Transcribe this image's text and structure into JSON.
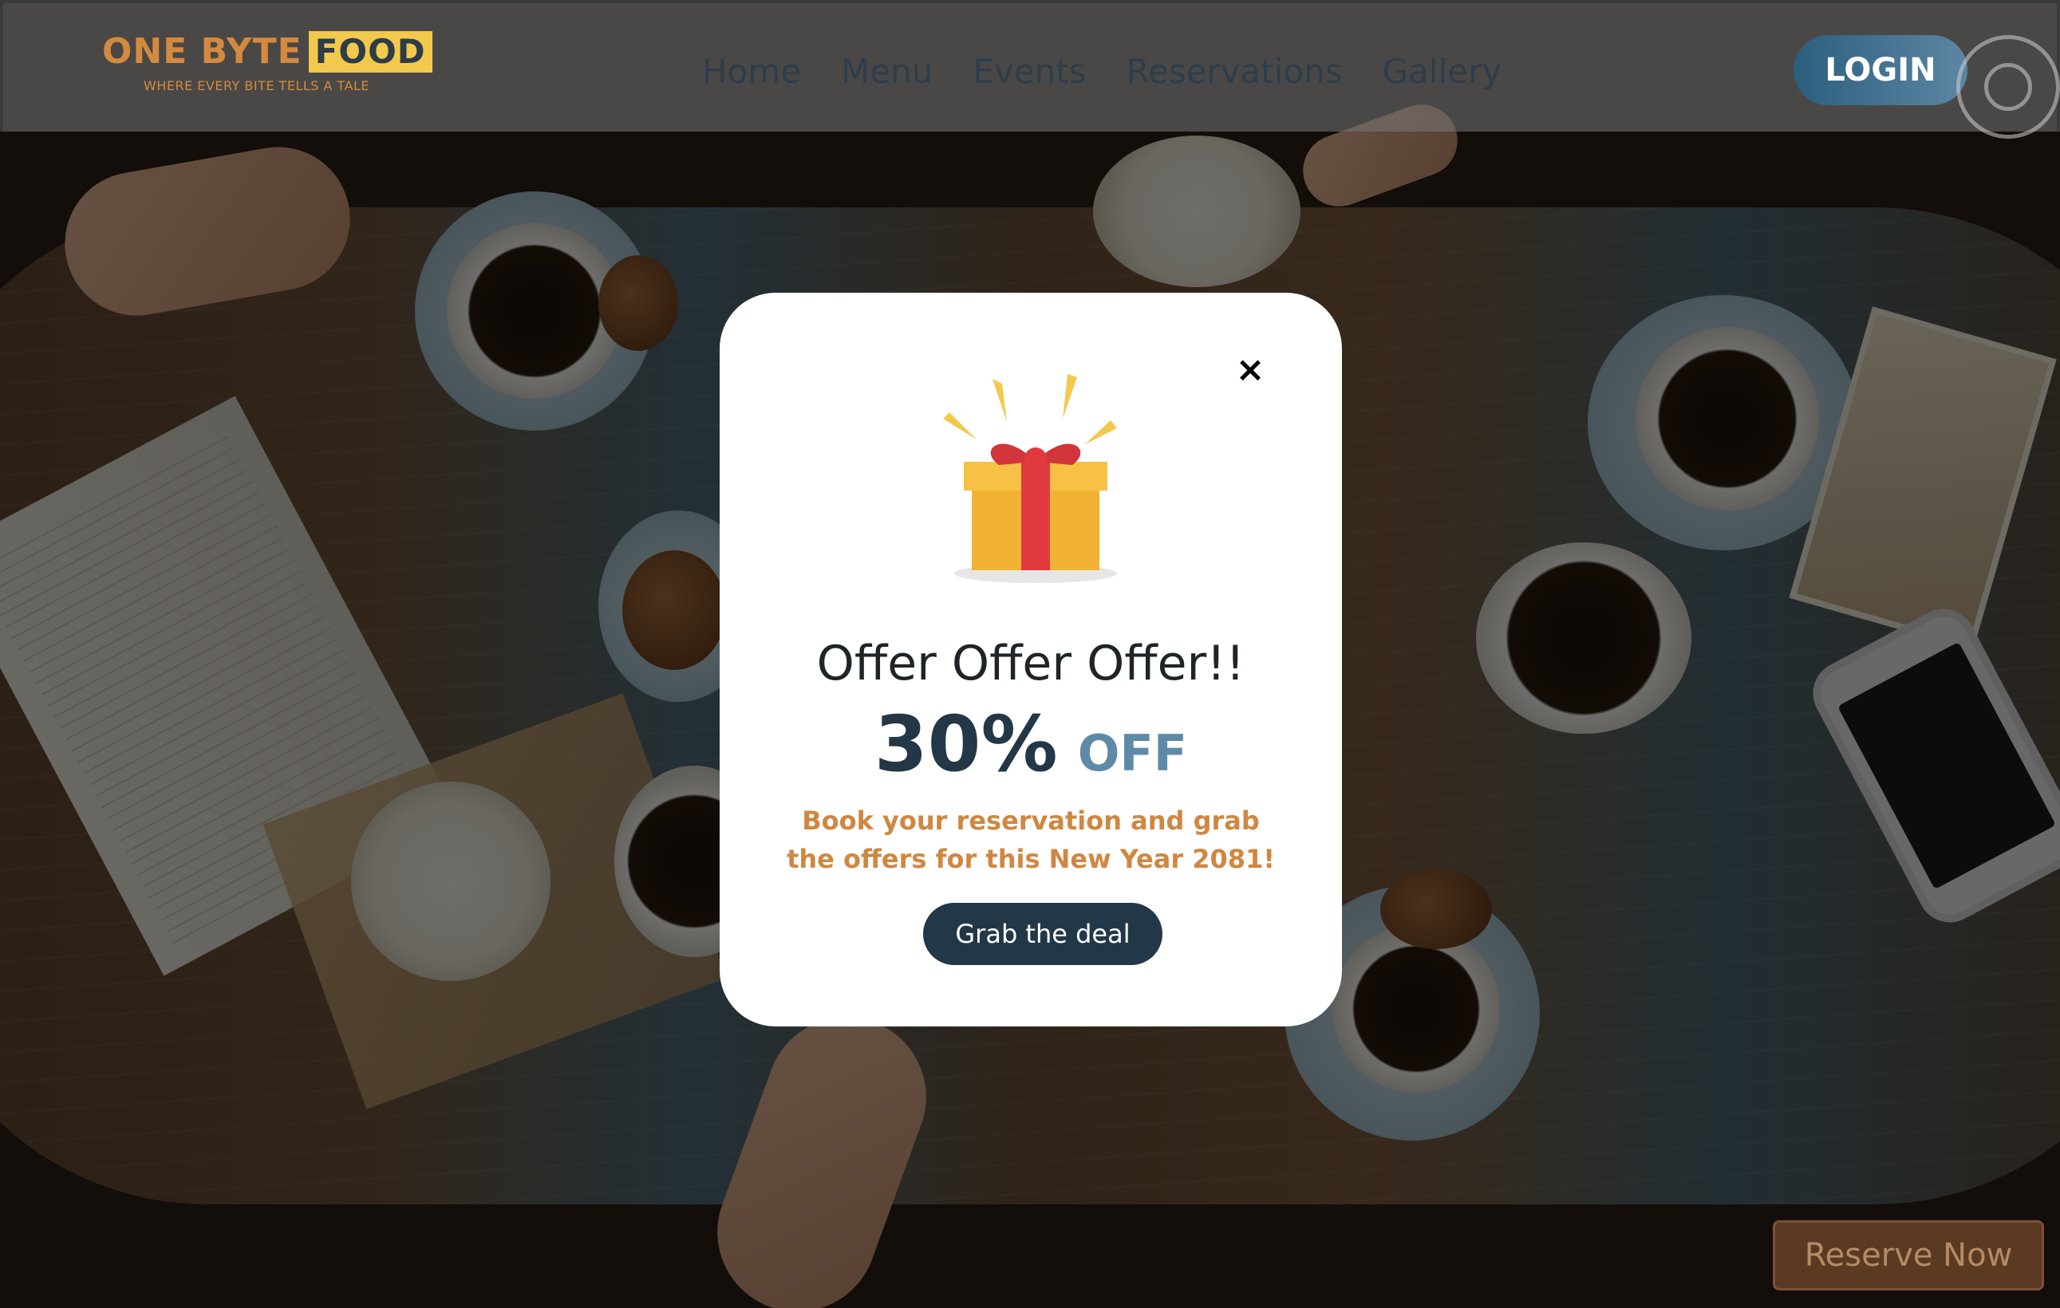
{
  "brand": {
    "name_first": "ONE BYTE",
    "name_second": "FOOD",
    "tagline": "WHERE EVERY BITE TELLS A TALE"
  },
  "nav": {
    "links": [
      "Home",
      "Menu",
      "Events",
      "Reservations",
      "Gallery"
    ],
    "login_label": "LOGIN"
  },
  "modal": {
    "close_symbol": "×",
    "title": "Offer Offer Offer!!",
    "discount_value": "30%",
    "discount_suffix": "OFF",
    "description": "Book your reservation and grab the offers for this New Year 2081!",
    "cta_label": "Grab the deal",
    "icon": "gift-icon"
  },
  "reserve": {
    "label": "Reserve Now"
  },
  "colors": {
    "brand_orange": "#d38a3f",
    "brand_yellow": "#f2c94c",
    "navy": "#223848",
    "discount_blue": "#5f8aa7",
    "reserve_brown": "#5a3a22"
  }
}
